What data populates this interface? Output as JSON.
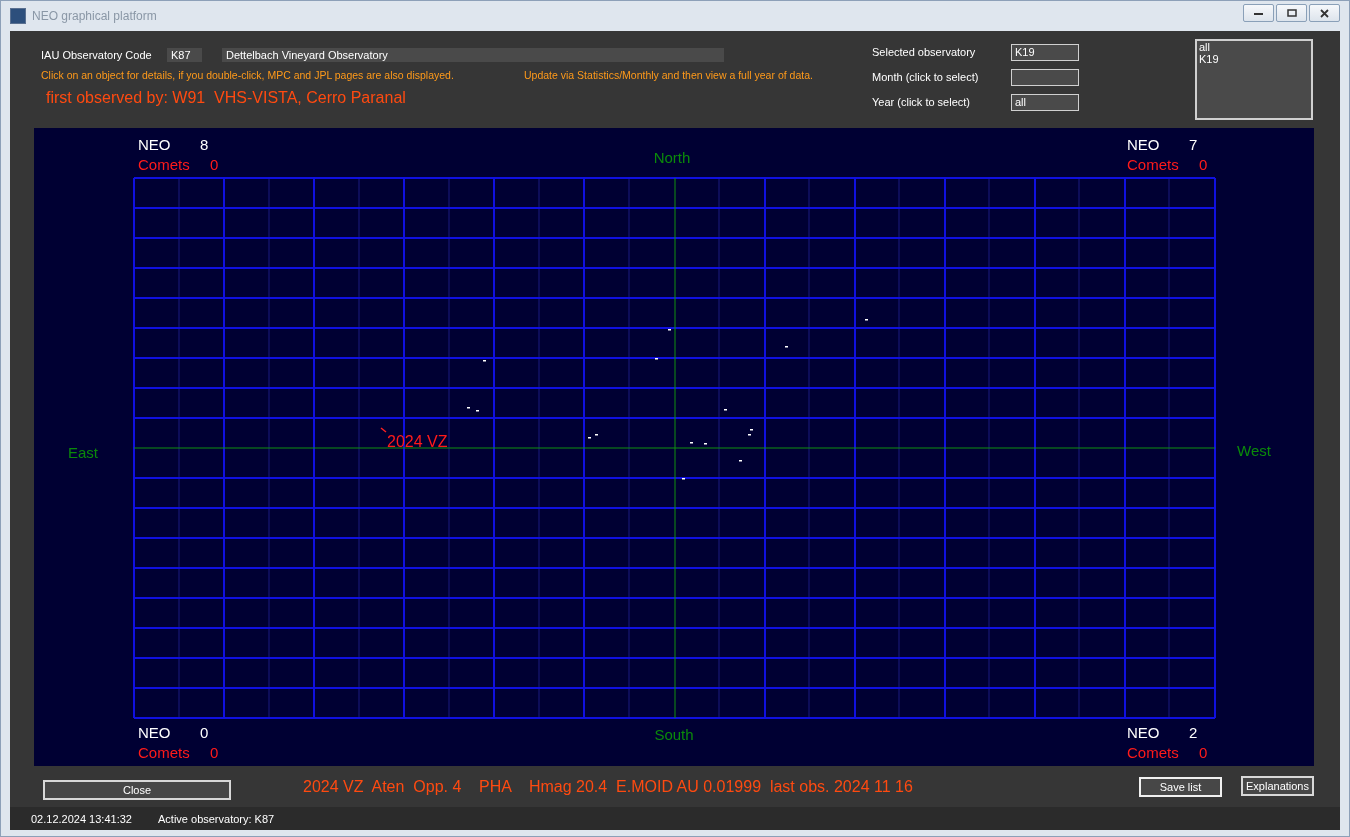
{
  "window": {
    "title": "NEO graphical platform"
  },
  "header": {
    "code_label": "IAU Observatory Code",
    "code": "K87",
    "observatory_name": "Dettelbach Vineyard Observatory",
    "click_hint": "Click on an object for details, if you double-click, MPC and JPL pages are also displayed.",
    "update_hint": "Update via Statistics/Monthly and then view a full year of data.",
    "first_observed": "first observed by: W91  VHS-VISTA, Cerro Paranal"
  },
  "filters": [
    {
      "label": "Selected observatory",
      "value": "K19"
    },
    {
      "label": "Month (click to select)"
    },
    {
      "label": "Year (click to select)",
      "value": "all"
    }
  ],
  "observatory_list": {
    "items": [
      "all",
      "K19"
    ]
  },
  "sky_map": {
    "compass": {
      "north": "North",
      "south": "South",
      "east": "East",
      "west": "West"
    },
    "corners": [
      {
        "neo_label": "NEO",
        "neo_count": "8",
        "comets_label": "Comets",
        "comets_count": "0"
      },
      {
        "neo_label": "NEO",
        "neo_count": "7",
        "comets_label": "Comets",
        "comets_count": "0"
      },
      {
        "neo_label": "NEO",
        "neo_count": "0",
        "comets_label": "Comets",
        "comets_count": "0"
      },
      {
        "neo_label": "NEO",
        "neo_count": "2",
        "comets_label": "Comets",
        "comets_count": "0"
      }
    ],
    "object_label": "2024 VZ"
  },
  "footer": {
    "close_button": "Close",
    "object_info": "2024 VZ  Aten  Opp. 4    PHA    Hmag 20.4  E.MOID AU 0.01999  last obs. 2024 11 16",
    "save_button": "Save list",
    "explanations_button": "Explanations"
  },
  "status_bar": {
    "date": "02.12.2024 13:41:32",
    "active_observatory": "Active observatory: K87"
  }
}
